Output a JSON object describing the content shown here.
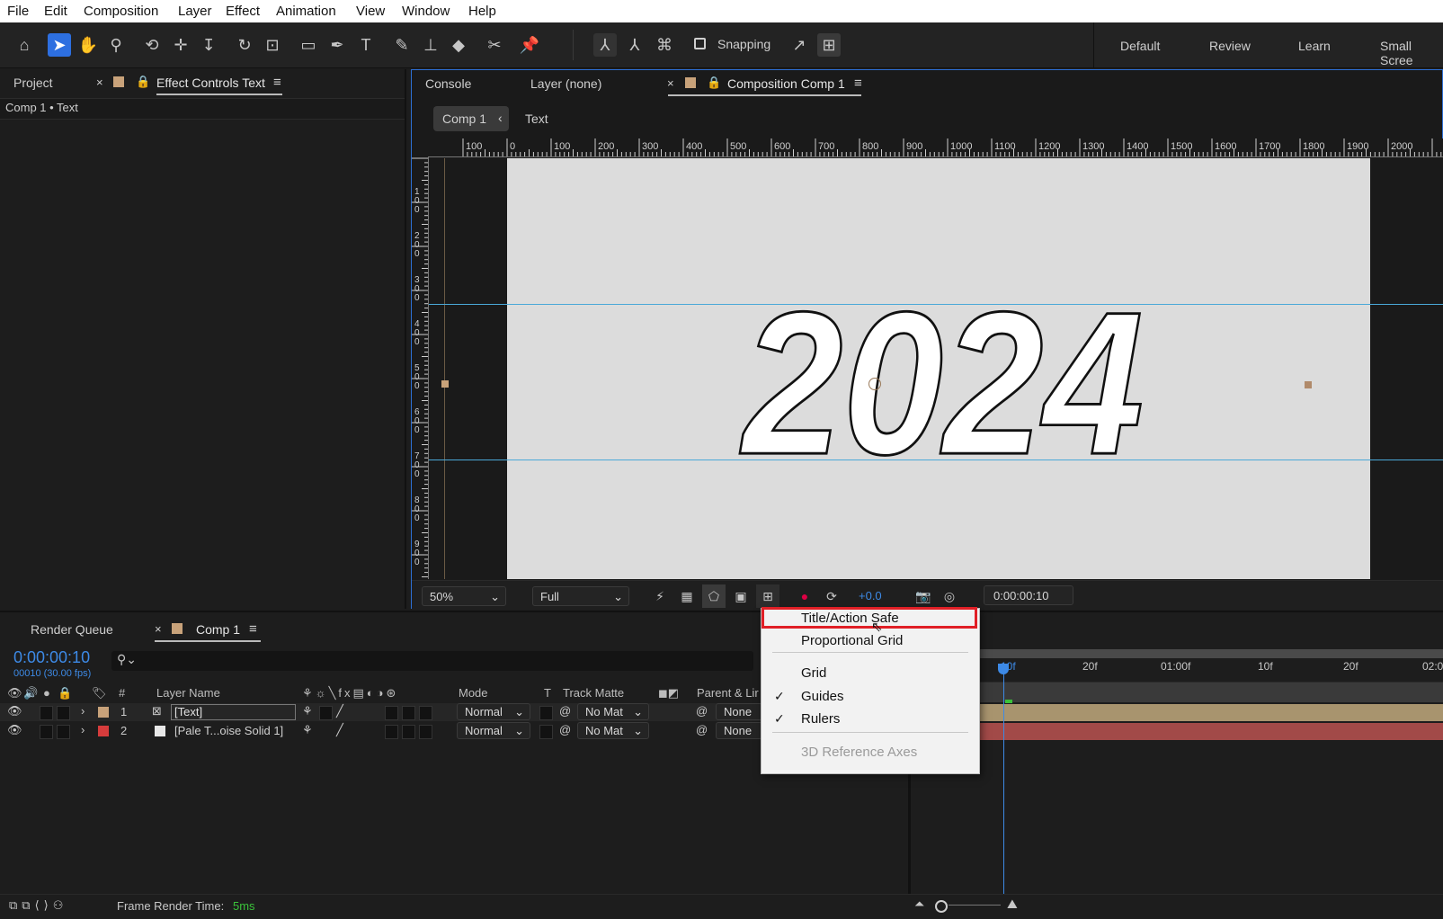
{
  "menubar": [
    "File",
    "Edit",
    "Composition",
    "Layer",
    "Effect",
    "Animation",
    "View",
    "Window",
    "Help"
  ],
  "toolbar": {
    "snapping_label": "Snapping",
    "workspaces": [
      "Default",
      "Review",
      "Learn",
      "Small Scree"
    ]
  },
  "left_panel": {
    "tab_project": "Project",
    "tab_effect_controls": "Effect Controls Text",
    "breadcrumb": "Comp 1 • Text"
  },
  "viewer": {
    "tab_console": "Console",
    "tab_layer": "Layer (none)",
    "tab_composition": "Composition Comp 1",
    "nav_comp": "Comp 1",
    "nav_text": "Text",
    "ruler_h": [
      "100",
      "0",
      "100",
      "200",
      "300",
      "400",
      "500",
      "600",
      "700",
      "800",
      "900",
      "1000",
      "1100",
      "1200",
      "1300",
      "1400",
      "1500",
      "1600",
      "1700",
      "1800",
      "1900",
      "2000"
    ],
    "ruler_v": [
      "1\n0\n0",
      "2\n0\n0",
      "3\n0\n0",
      "4\n0\n0",
      "5\n0\n0",
      "6\n0\n0",
      "7\n0\n0",
      "8\n0\n0",
      "9\n0\n0"
    ],
    "comp_text": "2024",
    "zoom": "50%",
    "resolution": "Full",
    "exposure": "+0.0",
    "timecode": "0:00:00:10"
  },
  "dropdown": {
    "items": [
      {
        "label": "Title/Action Safe",
        "checked": false,
        "highlighted": true,
        "disabled": false
      },
      {
        "label": "Proportional Grid",
        "checked": false,
        "disabled": false
      },
      {
        "label": "Grid",
        "checked": false,
        "disabled": false
      },
      {
        "label": "Guides",
        "checked": true,
        "disabled": false
      },
      {
        "label": "Rulers",
        "checked": true,
        "disabled": false
      },
      {
        "label": "3D Reference Axes",
        "checked": false,
        "disabled": true
      }
    ]
  },
  "timeline": {
    "tab_render_queue": "Render Queue",
    "tab_comp": "Comp 1",
    "timecode": "0:00:00:10",
    "fps": "00010 (30.00 fps)",
    "search_placeholder": "",
    "columns": {
      "hash": "#",
      "layer_name": "Layer Name",
      "mode": "Mode",
      "t": "T",
      "track_matte": "Track Matte",
      "parent": "Parent & Lir"
    },
    "layers": [
      {
        "num": "1",
        "name": "[Text]",
        "mode": "Normal",
        "matte": "No Mat",
        "parent": "None",
        "color": "#c8a27a"
      },
      {
        "num": "2",
        "name": "[Pale T...oise Solid 1]",
        "mode": "Normal",
        "matte": "No Mat",
        "parent": "None",
        "color": "#d63c3c"
      }
    ],
    "ruler_labels": [
      "20f",
      "01:00f",
      "10f",
      "20f",
      "02:0"
    ],
    "current_marker": "10f",
    "frame_render_label": "Frame Render Time:",
    "frame_render_value": "5ms"
  }
}
